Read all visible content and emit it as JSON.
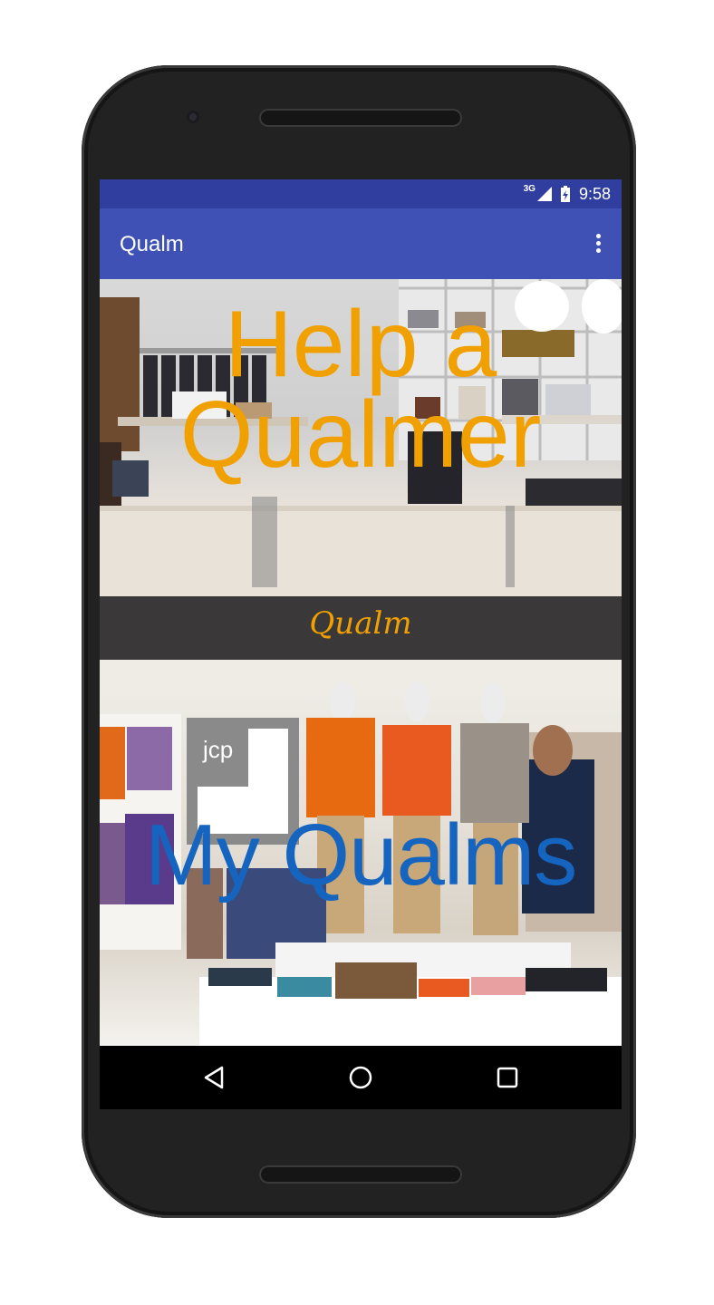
{
  "status_bar": {
    "network_label": "3G",
    "time": "9:58",
    "icons": [
      "signal-icon",
      "battery-icon"
    ]
  },
  "app_bar": {
    "title": "Qualm",
    "menu_icon": "more-vert-icon"
  },
  "panels": {
    "help": {
      "line1": "Help a",
      "line2": "Qualmer",
      "color": "#f0a000"
    },
    "banner": {
      "logo_text": "Qualm",
      "color": "#f0a000"
    },
    "my_qualms": {
      "label": "My Qualms",
      "sign_text": "jcp",
      "color": "#1565c0"
    }
  },
  "nav_bar": {
    "icons": [
      "back-icon",
      "home-icon",
      "recents-icon"
    ]
  },
  "colors": {
    "status_bar": "#303f9f",
    "app_bar": "#3f51b5",
    "banner": "#3b3839",
    "nav_bar": "#000000"
  }
}
